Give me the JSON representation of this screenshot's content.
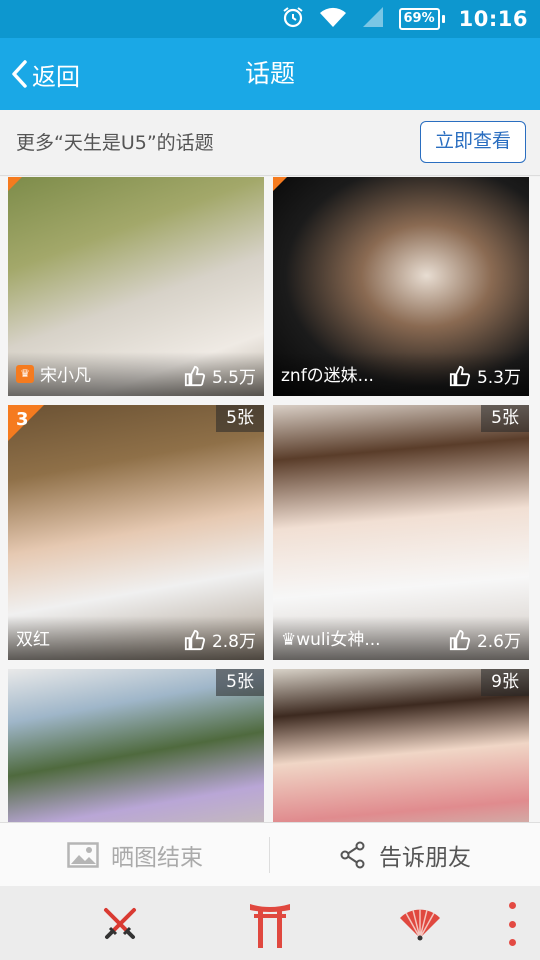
{
  "status_bar": {
    "battery": "69%",
    "time": "10:16"
  },
  "header": {
    "back_label": "返回",
    "title": "话题"
  },
  "promo": {
    "text": "更多“天生是U5”的话题",
    "button_label": "立即查看"
  },
  "cards": [
    {
      "name": "宋小凡",
      "likes": "5.5万",
      "count": "",
      "rank": ""
    },
    {
      "name": "znfの迷妹...",
      "likes": "5.3万",
      "count": "",
      "rank": ""
    },
    {
      "name": "双红",
      "likes": "2.8万",
      "count": "5张",
      "rank": "3"
    },
    {
      "name": "♛wuli女神...",
      "likes": "2.6万",
      "count": "5张",
      "rank": ""
    },
    {
      "name": "",
      "likes": "",
      "count": "5张",
      "rank": ""
    },
    {
      "name": "",
      "likes": "",
      "count": "9张",
      "rank": ""
    }
  ],
  "actions": {
    "left_label": "晒图结束",
    "right_label": "告诉朋友"
  },
  "tabbar": {
    "icons": [
      "swords-icon",
      "torii-gate-icon",
      "folding-fan-icon"
    ]
  },
  "colors": {
    "status_bar": "#0d97cf",
    "title_bar": "#1aa8e6",
    "accent_orange": "#f57b1f",
    "button_blue": "#2a6ec0",
    "tab_red": "#e34a43"
  }
}
